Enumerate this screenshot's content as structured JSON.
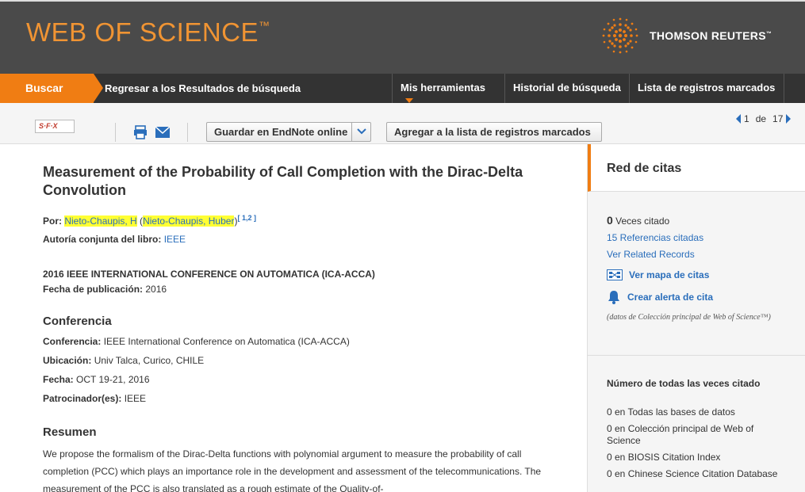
{
  "header": {
    "logo_left": "WEB OF SCIENCE",
    "logo_left_tm": "™",
    "logo_right": "THOMSON REUTERS",
    "logo_right_tm": "™",
    "brand_orange": "#f07d13"
  },
  "nav": {
    "search": "Buscar",
    "back": "Regresar a los Resultados de búsqueda",
    "tools": "Mis herramientas",
    "history": "Historial de búsqueda",
    "marked_list": "Lista de registros marcados"
  },
  "toolbar": {
    "sfx": "S·F·X",
    "endnote": "Guardar en EndNote online",
    "add_marked": "Agregar a la lista de registros marcados",
    "pager_current": "1",
    "pager_of": "de",
    "pager_total": "17"
  },
  "record": {
    "title": "Measurement of the Probability of Call Completion with the Dirac-Delta Convolution",
    "by_label": "Por:",
    "author_short": "Nieto-Chaupis, H",
    "author_full": "Nieto-Chaupis, Huber",
    "author_refs": "[ 1,2 ]",
    "coauthor_label": "Autoría conjunta del libro:",
    "coauthor_value": "IEEE",
    "source": "2016 IEEE INTERNATIONAL CONFERENCE ON AUTOMATICA (ICA-ACCA)",
    "pubdate_label": "Fecha de publicación:",
    "pubdate_value": "2016",
    "conf_section": "Conferencia",
    "conf_label": "Conferencia:",
    "conf_value": "IEEE International Conference on Automatica (ICA-ACCA)",
    "loc_label": "Ubicación:",
    "loc_value": "Univ Talca, Curico, CHILE",
    "date_label": "Fecha:",
    "date_value": "OCT 19-21, 2016",
    "sponsor_label": "Patrocinador(es):",
    "sponsor_value": "IEEE",
    "abstract_section": "Resumen",
    "abstract_text": "We propose the formalism of the Dirac-Delta functions with polynomial argument to measure the probability of call completion (PCC) which plays an importance role in the development and assessment of the telecommunications. The measurement of the PCC is also translated as a rough estimate of the Quality-of-"
  },
  "sidebar": {
    "heading": "Red de citas",
    "cited_count": "0",
    "cited_label": "Veces citado",
    "refs_link": "15 Referencias citadas",
    "related_link": "Ver Related Records",
    "map_link": "Ver mapa de citas",
    "alert_link": "Crear alerta de cita",
    "note": "(datos de Colección principal de Web of Science™)",
    "all_times_heading": "Número de todas las veces citado",
    "counts": [
      "0 en Todas las bases de datos",
      "0 en Colección principal de Web of Science",
      "0 en BIOSIS Citation Index",
      "0 en Chinese Science Citation Database"
    ]
  }
}
